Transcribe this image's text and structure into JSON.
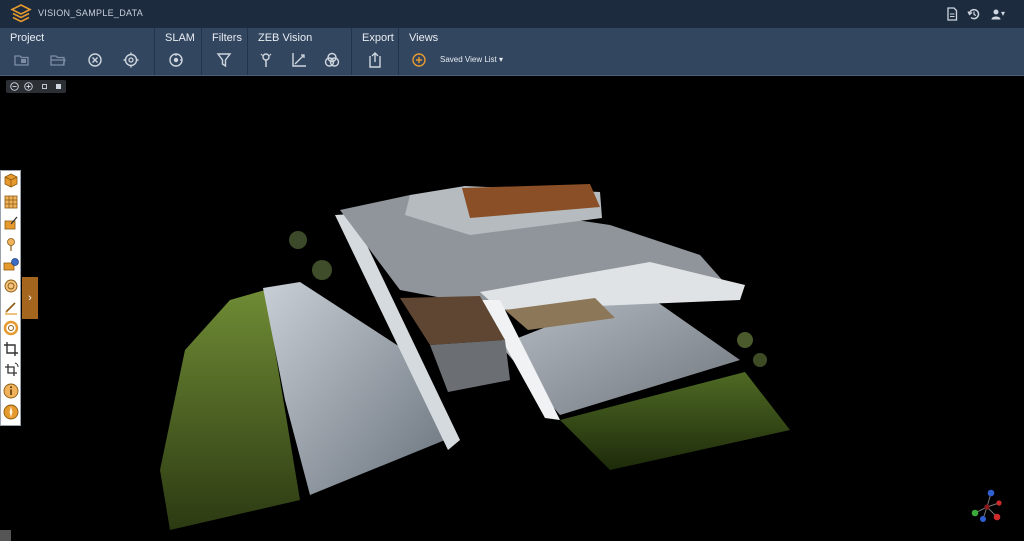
{
  "app": {
    "title": "VISION_SAMPLE_DATA",
    "logo_icon": "layers-logo-icon",
    "header_icons": [
      "document-icon",
      "history-icon",
      "user-icon"
    ],
    "user_menu_caret": "▾"
  },
  "toolbar": {
    "groups": [
      {
        "label": "Project",
        "tools": [
          "open-folder-icon",
          "folder-icon",
          "close-circle-icon",
          "settings-icon"
        ]
      },
      {
        "label": "SLAM",
        "tools": [
          "slam-icon"
        ]
      },
      {
        "label": "Filters",
        "tools": [
          "filter-icon"
        ]
      },
      {
        "label": "ZEB Vision",
        "tools": [
          "pin-icon",
          "crop-axes-icon",
          "overlap-icon"
        ]
      },
      {
        "label": "Export",
        "tools": [
          "export-icon"
        ]
      },
      {
        "label": "Views",
        "tools": [
          "add-view-icon"
        ]
      }
    ],
    "saved_view_list": "Saved View List",
    "saved_view_caret": "▾"
  },
  "viewport_controls": [
    "zoom-out-icon",
    "zoom-in-icon",
    "small-square-icon",
    "filled-square-icon"
  ],
  "left_tools": [
    "box-icon",
    "grid-icon",
    "paint-icon",
    "pin-tool-icon",
    "camera-globe-icon",
    "target-icon",
    "brush-icon",
    "ring-icon",
    "crop-icon",
    "crop-rotate-icon",
    "info-icon",
    "compass-icon"
  ],
  "expand_tab": {
    "icon": "chevron-right-icon",
    "glyph": "›"
  },
  "colors": {
    "titlebar": "#1c2b3e",
    "toolbar": "#33465f",
    "accent": "#e69a2e",
    "expand_tab": "#a4651f"
  }
}
